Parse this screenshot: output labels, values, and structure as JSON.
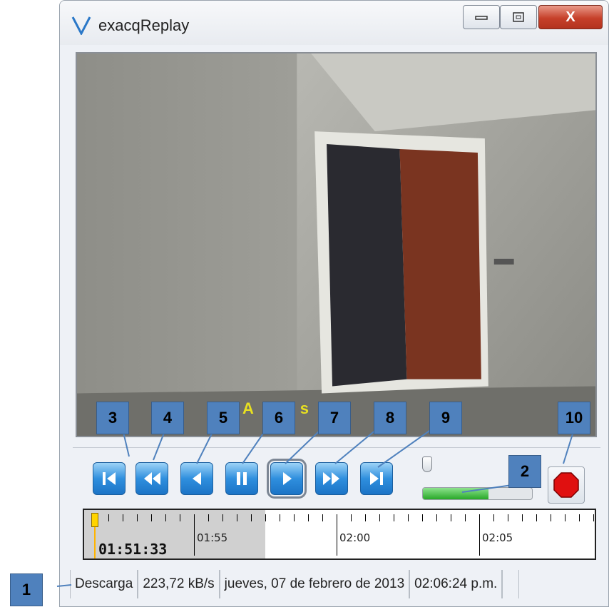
{
  "window": {
    "title": "exacqReplay",
    "close_glyph": "X",
    "logo_icon": "exacq-v-logo-icon"
  },
  "video": {
    "overlay_text": "A g s y"
  },
  "controls": {
    "buttons": [
      {
        "name": "skip-to-start",
        "icon": "skip-start-icon"
      },
      {
        "name": "rewind",
        "icon": "rewind-icon"
      },
      {
        "name": "step-back",
        "icon": "step-back-icon"
      },
      {
        "name": "pause",
        "icon": "pause-icon"
      },
      {
        "name": "play",
        "icon": "play-icon",
        "active": true
      },
      {
        "name": "fast-forward",
        "icon": "fast-forward-icon"
      },
      {
        "name": "skip-to-end",
        "icon": "skip-end-icon"
      }
    ],
    "buffer_progress": 0.6,
    "stop_icon": "stop-sign-icon"
  },
  "timeline": {
    "labels": [
      "01:55",
      "02:00",
      "02:05"
    ],
    "current_time": "01:51:33"
  },
  "statusbar": {
    "mode": "Descarga",
    "rate": "223,72 kB/s",
    "date": "jueves, 07 de febrero de 2013",
    "time": "02:06:24 p.m."
  },
  "callouts": [
    "1",
    "2",
    "3",
    "4",
    "5",
    "6",
    "7",
    "8",
    "9",
    "10"
  ],
  "colors": {
    "callout_fill": "#4f81bd",
    "button_blue": "#2f8fde",
    "buffer_green": "#28a828",
    "stop_red": "#e01010",
    "overlay_yellow": "#e8e020"
  }
}
